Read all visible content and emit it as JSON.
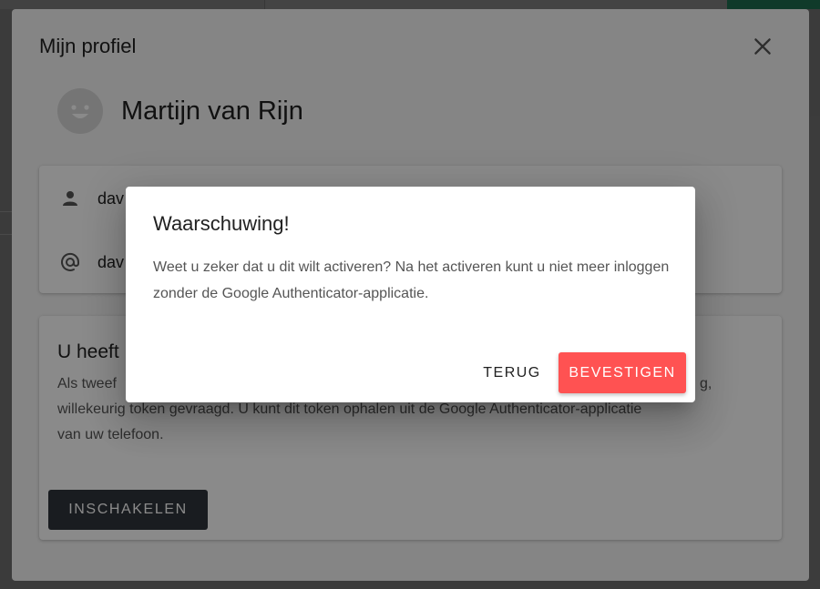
{
  "profile_dialog": {
    "title": "Mijn profiel",
    "close_icon": "close-icon",
    "user_name": "Martijn van Rijn",
    "avatar_icon": "smiley-avatar-icon",
    "username_fragment": "dav",
    "email_fragment": "dav",
    "user_icon": "person-icon",
    "email_icon": "at-sign-icon"
  },
  "two_factor_card": {
    "title_fragment": "U heeft",
    "text_line1": "Als tweef",
    "text_line1_end": "g,",
    "text_line2": "willekeurig token gevraagd. U kunt dit token ophalen uit de Google Authenticator-applicatie",
    "text_line3": "van uw telefoon.",
    "button_label": "INSCHAKELEN"
  },
  "warning_dialog": {
    "title": "Waarschuwing!",
    "text": "Weet u zeker dat u dit wilt activeren? Na het activeren kunt u niet meer inloggen zonder de Google Authenticator-applicatie.",
    "back_label": "TERUG",
    "confirm_label": "BEVESTIGEN"
  },
  "colors": {
    "confirm": "#ff5252",
    "dark_button": "#2f343b",
    "scrim": "rgba(0,0,0,0.46)"
  }
}
